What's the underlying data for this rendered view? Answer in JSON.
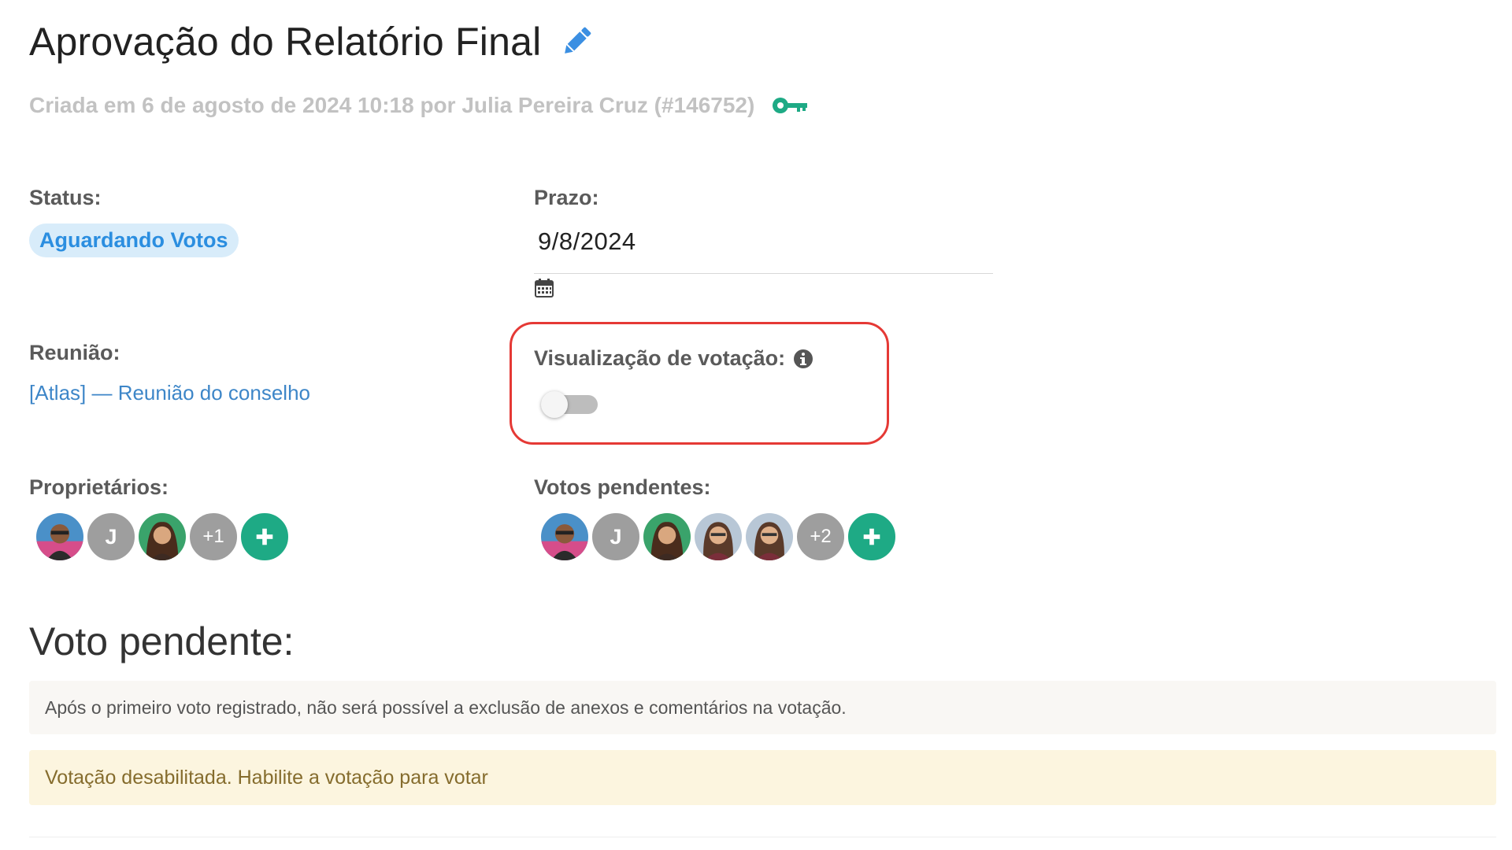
{
  "header": {
    "title": "Aprovação do Relatório Final",
    "created_text": "Criada em 6 de agosto de 2024 10:18 por Julia Pereira Cruz (#146752)",
    "accent_color": "#1eaa85",
    "edit_icon": "pencil-icon",
    "key_icon": "key-icon"
  },
  "status": {
    "label": "Status:",
    "value": "Aguardando Votos",
    "color": "#2b8ee0"
  },
  "deadline": {
    "label": "Prazo:",
    "value": "9/8/2024",
    "icon": "calendar-icon"
  },
  "meeting": {
    "label": "Reunião:",
    "link_text": "[Atlas] — Reunião do conselho"
  },
  "voting_visibility": {
    "label": "Visualização de votação:",
    "enabled": false,
    "info_icon": "info-icon"
  },
  "owners": {
    "label": "Proprietários:",
    "avatars": [
      {
        "type": "photo"
      },
      {
        "type": "letter",
        "text": "J"
      },
      {
        "type": "photo"
      },
      {
        "type": "more",
        "text": "+1"
      },
      {
        "type": "add",
        "icon": "plus-icon"
      }
    ]
  },
  "pending_votes": {
    "label": "Votos pendentes:",
    "avatars": [
      {
        "type": "photo"
      },
      {
        "type": "letter",
        "text": "J"
      },
      {
        "type": "photo"
      },
      {
        "type": "photo"
      },
      {
        "type": "photo"
      },
      {
        "type": "more",
        "text": "+2"
      },
      {
        "type": "add",
        "icon": "plus-icon"
      }
    ]
  },
  "vote_section": {
    "title": "Voto pendente:",
    "notice": "Após o primeiro voto registrado, não será possível a exclusão de anexos e comentários na votação.",
    "warning": "Votação desabilitada. Habilite a votação para votar"
  }
}
